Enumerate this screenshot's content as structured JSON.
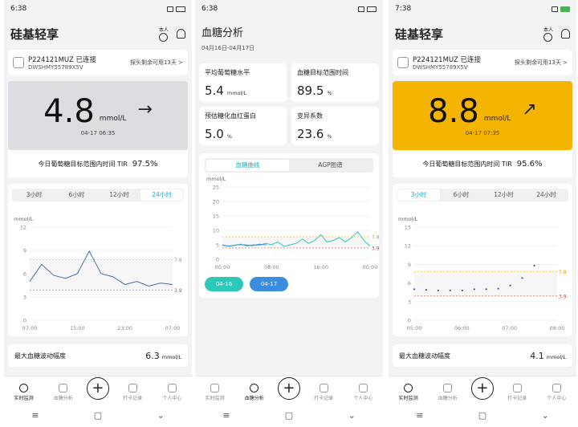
{
  "panel1": {
    "status_time": "6:38",
    "app_title": "硅基轻享",
    "person_label": "本人",
    "device_name": "P224121MUZ 已连接",
    "device_serial": "DWSHMY55789X5V",
    "sensor_days": "探头剩余可用13天",
    "glucose_value": "4.8",
    "glucose_unit": "mmol/L",
    "trend_arrow": "→",
    "reading_time": "04-17 06:35",
    "tir_label": "今日葡萄糖目标范围内时间 TIR",
    "tir_value": "97.5%",
    "tabs": [
      "3小时",
      "6小时",
      "12小时",
      "24小时"
    ],
    "active_tab": 3,
    "metric_label": "最大血糖波动幅度",
    "metric_value": "6.3",
    "metric_unit": "mmol/L"
  },
  "panel2": {
    "status_time": "6:38",
    "title": "血糖分析",
    "date_range": "04月16日-04月17日",
    "stats": [
      {
        "label": "平均葡萄糖水平",
        "value": "5.4",
        "unit": "mmol/L"
      },
      {
        "label": "血糖目标范围时间",
        "value": "89.5",
        "unit": "%"
      },
      {
        "label": "预估糖化血红蛋白",
        "value": "5.0",
        "unit": "%"
      },
      {
        "label": "变异系数",
        "value": "23.6",
        "unit": "%"
      }
    ],
    "seg_curve": "血糖曲线",
    "seg_agp": "AGP图谱",
    "day1": "04-16",
    "day2": "04-17"
  },
  "panel3": {
    "status_time": "7:38",
    "app_title": "硅基轻享",
    "person_label": "本人",
    "device_name": "P224121MUZ 已连接",
    "device_serial": "DWSHMY55789X5V",
    "sensor_days": "探头剩余可用13天",
    "glucose_value": "8.8",
    "glucose_unit": "mmol/L",
    "trend_arrow": "↗",
    "reading_time": "04-17 07:35",
    "tir_label": "今日葡萄糖目标范围内时间 TIR",
    "tir_value": "95.6%",
    "tabs": [
      "3小时",
      "6小时",
      "12小时",
      "24小时"
    ],
    "active_tab": 0,
    "metric_label": "最大血糖波动幅度",
    "metric_value": "4.1",
    "metric_unit": "mmol/L"
  },
  "nav": {
    "live": "实时监测",
    "analysis": "血糖分析",
    "plus": "+",
    "log": "打卡记录",
    "me": "个人中心"
  },
  "chart_labels": {
    "unit": "mmol/L",
    "high": "7.8",
    "low": "3.9",
    "p1_x": [
      "07:00",
      "15:00",
      "23:00",
      "07:00"
    ],
    "p2_x": [
      "00:00",
      "08:00",
      "16:00",
      "00:00"
    ],
    "p3_x": [
      "05:00",
      "06:00",
      "07:00",
      "08:00"
    ],
    "y_small": [
      "12",
      "9",
      "6",
      "3",
      "0"
    ],
    "y_big": [
      "25",
      "20",
      "15",
      "10",
      "5",
      "0"
    ],
    "y_p3": [
      "15",
      "12",
      "9",
      "6",
      "3",
      "0"
    ]
  },
  "chart_data": [
    {
      "type": "line",
      "title": "",
      "ylabel": "mmol/L",
      "x": [
        "07:00",
        "09:00",
        "11:00",
        "13:00",
        "15:00",
        "17:00",
        "19:00",
        "21:00",
        "23:00",
        "01:00",
        "03:00",
        "05:00",
        "07:00"
      ],
      "values": [
        5.0,
        7.2,
        5.8,
        5.4,
        6.0,
        8.9,
        6.0,
        5.6,
        4.6,
        5.0,
        4.4,
        4.8,
        4.6
      ],
      "ylim": [
        0,
        12
      ],
      "target_range": [
        3.9,
        7.8
      ]
    },
    {
      "type": "line",
      "title": "",
      "ylabel": "mmol/L",
      "series": [
        {
          "name": "04-16",
          "values": [
            5.0,
            4.5,
            4.8,
            5.2,
            4.6,
            5.0,
            4.8,
            5.5,
            5.0,
            6.0,
            4.5,
            5.0,
            5.5,
            7.0,
            5.5,
            6.5,
            8.5,
            6.0,
            6.5,
            7.5,
            6.0,
            7.5,
            9.5,
            6.5,
            4.5
          ]
        },
        {
          "name": "04-17",
          "values": [
            4.8,
            4.6,
            5.0,
            5.0,
            4.7,
            5.2,
            5.0
          ]
        }
      ],
      "x": [
        "00:00",
        "08:00",
        "16:00",
        "00:00"
      ],
      "ylim": [
        0,
        25
      ],
      "target_range": [
        3.9,
        7.8
      ]
    },
    {
      "type": "scatter",
      "title": "",
      "ylabel": "mmol/L",
      "x": [
        "05:00",
        "05:15",
        "05:30",
        "05:45",
        "06:00",
        "06:15",
        "06:30",
        "06:45",
        "07:00",
        "07:15",
        "07:30"
      ],
      "values": [
        5.0,
        4.9,
        4.8,
        4.8,
        4.8,
        5.0,
        5.0,
        5.1,
        5.6,
        6.8,
        8.8
      ],
      "ylim": [
        0,
        15
      ],
      "target_range": [
        3.9,
        7.8
      ]
    }
  ]
}
